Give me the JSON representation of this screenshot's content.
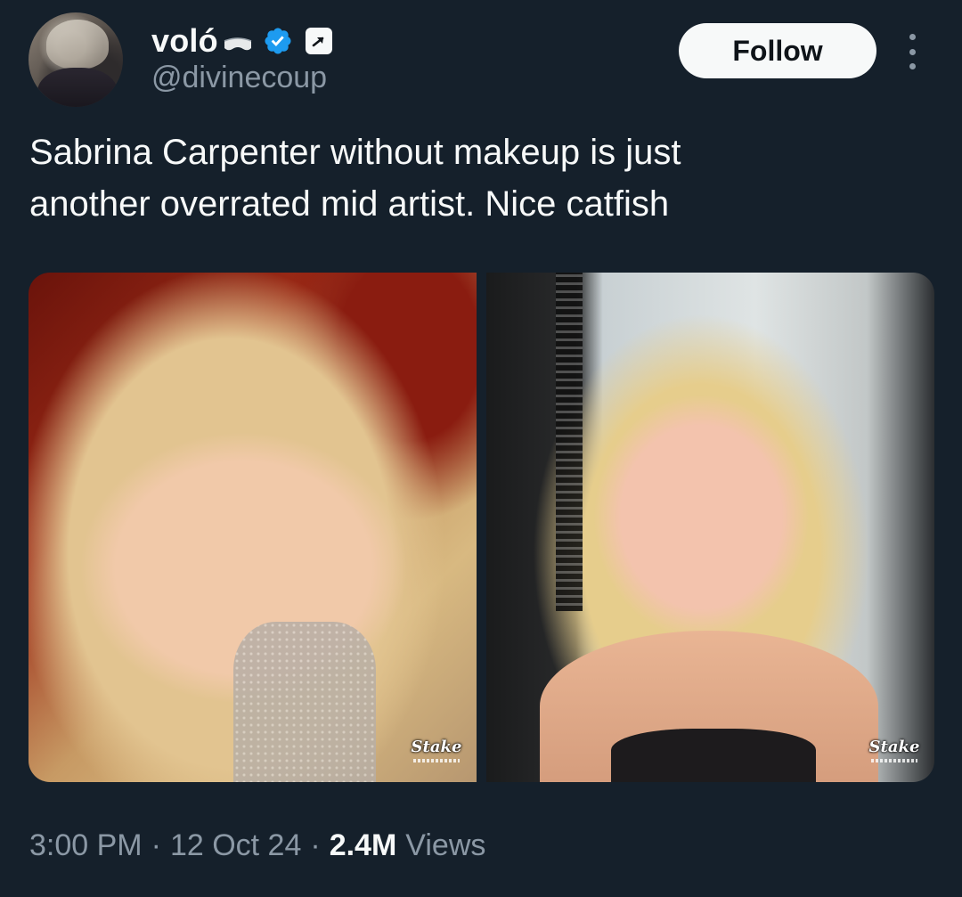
{
  "author": {
    "display_name": "voló",
    "handle": "@divinecoup",
    "verified": true,
    "avatar": "user-avatar",
    "name_emoji_icon": "vr-headset-icon",
    "affiliate_badge_icon": "arrow-badge-icon"
  },
  "actions": {
    "follow_label": "Follow",
    "more_icon": "more-options-icon"
  },
  "tweet": {
    "text": "Sabrina Carpenter without makeup is just\nanother overrated mid artist. Nice catfish"
  },
  "media": {
    "photos": [
      {
        "name": "photo-with-makeup",
        "watermark": "Stake"
      },
      {
        "name": "photo-without-makeup",
        "watermark": "Stake"
      }
    ]
  },
  "meta": {
    "time": "3:00 PM",
    "date": "12 Oct 24",
    "views_count": "2.4M",
    "views_label": "Views",
    "separator": "·"
  },
  "colors": {
    "background": "#15202b",
    "text_primary": "#f7f9f9",
    "text_secondary": "#8b98a5",
    "verified_blue": "#1d9bf0",
    "follow_bg": "#f7f9f9"
  }
}
